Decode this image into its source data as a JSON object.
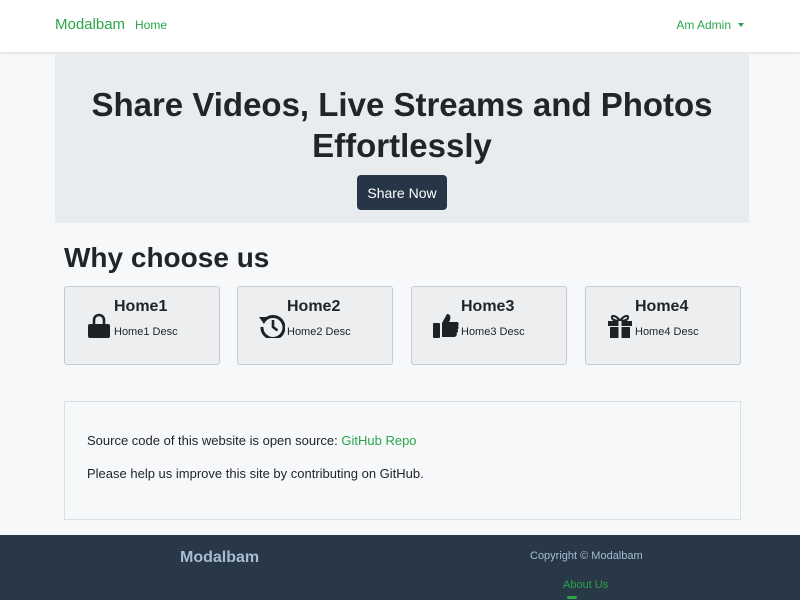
{
  "navbar": {
    "brand": "Modalbam",
    "home_link": "Home",
    "user_menu": "Am Admin"
  },
  "hero": {
    "title": "Share Videos, Live Streams and Photos Effortlessly",
    "button_label": "Share Now"
  },
  "why": {
    "title": "Why choose us",
    "cards": [
      {
        "title": "Home1",
        "desc": "Home1 Desc",
        "icon": "lock-icon"
      },
      {
        "title": "Home2",
        "desc": "Home2 Desc",
        "icon": "history-icon"
      },
      {
        "title": "Home3",
        "desc": "Home3 Desc",
        "icon": "thumbs-up-icon"
      },
      {
        "title": "Home4",
        "desc": "Home4 Desc",
        "icon": "gift-icon"
      }
    ]
  },
  "info": {
    "source_text": "Source code of this website is open source: ",
    "repo_link": "GitHub Repo",
    "help_text": "Please help us improve this site by contributing on GitHub."
  },
  "footer": {
    "brand": "Modalbam",
    "copyright": "Copyright © Modalbam",
    "about_link": "About Us"
  },
  "colors": {
    "accent": "#2aa64a",
    "hero_bg": "#e9ecef",
    "button_bg": "#263646",
    "footer_bg": "#293847"
  }
}
